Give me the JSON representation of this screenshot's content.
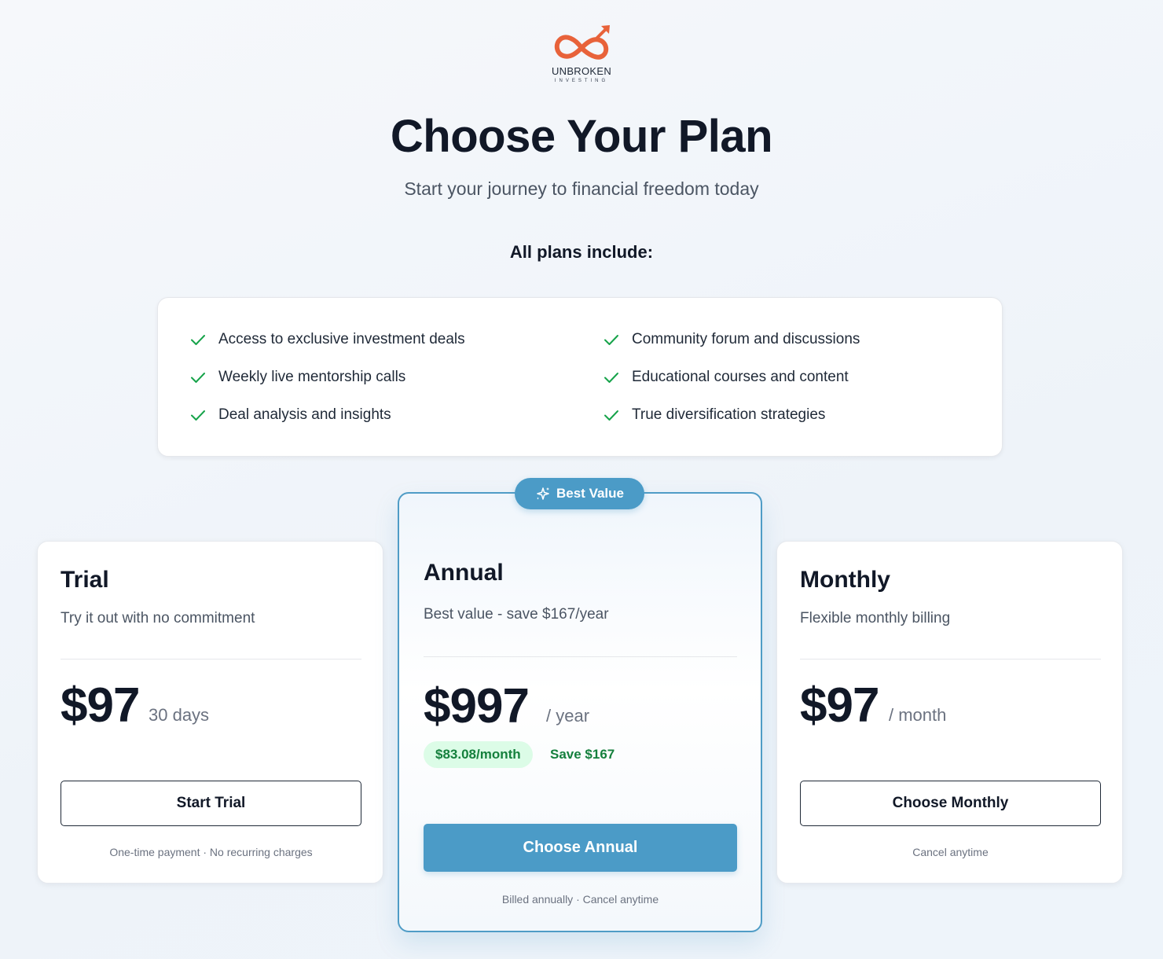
{
  "brand": {
    "name": "UNBROKEN",
    "tagline": "INVESTING",
    "accent_color": "#e8623a"
  },
  "header": {
    "title": "Choose Your Plan",
    "subtitle": "Start your journey to financial freedom today"
  },
  "includes": {
    "title": "All plans include:",
    "items": [
      "Access to exclusive investment deals",
      "Weekly live mentorship calls",
      "Deal analysis and insights",
      "Community forum and discussions",
      "Educational courses and content",
      "True diversification strategies"
    ],
    "icon": "check-icon",
    "check_color": "#16a34a"
  },
  "plans": {
    "trial": {
      "name": "Trial",
      "description": "Try it out with no commitment",
      "price": "$97",
      "period": "30 days",
      "button": "Start Trial",
      "note": "One-time payment · No recurring charges"
    },
    "annual": {
      "badge": "Best Value",
      "badge_icon": "sparkle-icon",
      "name": "Annual",
      "description": "Best value - save $167/year",
      "price": "$997",
      "period": "/ year",
      "monthly_equivalent": "$83.08/month",
      "savings": "Save $167",
      "button": "Choose Annual",
      "note": "Billed annually · Cancel anytime",
      "accent_color": "#4b9bc7"
    },
    "monthly": {
      "name": "Monthly",
      "description": "Flexible monthly billing",
      "price": "$97",
      "period": "/ month",
      "button": "Choose Monthly",
      "note": "Cancel anytime"
    }
  }
}
